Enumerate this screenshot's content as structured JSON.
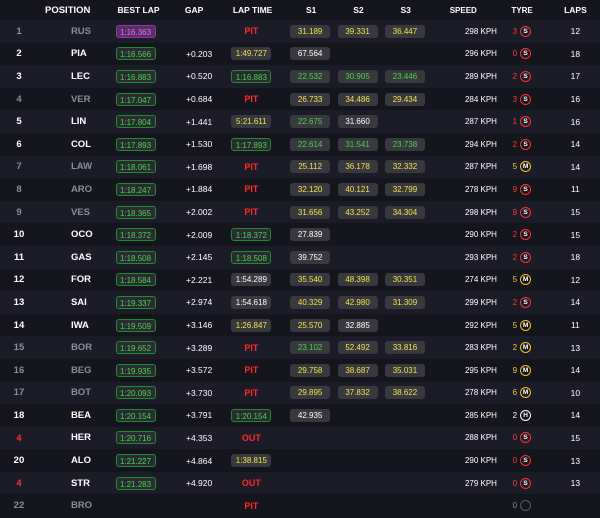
{
  "headers": {
    "position": "POSITION",
    "best_lap": "BEST LAP",
    "gap": "GAP",
    "lap_time": "LAP TIME",
    "s1": "S1",
    "s2": "S2",
    "s3": "S3",
    "speed": "SPEED",
    "tyre": "TYRE",
    "laps": "LAPS"
  },
  "colors": {
    "background": "#15151e",
    "row_alt": "#1c1c28",
    "personal_best": "#4ad34a",
    "sector_yellow": "#f2e34a",
    "fastest_purple": "#d77bd7",
    "pit_red": "#ff2a2a"
  },
  "rows": [
    {
      "pos": "1",
      "driver": "RUS",
      "dim": true,
      "best": "1:16.363",
      "best_style": "purple",
      "gap": "",
      "lt": "PIT",
      "lt_style": "pit",
      "s1": "31.189",
      "s1c": "yellow",
      "s2": "39.331",
      "s2c": "yellow",
      "s3": "36.447",
      "s3c": "yellow",
      "speed": "298 KPH",
      "tyre_age": "3",
      "tyre_age_color": "red",
      "tyre": "S",
      "laps": "12"
    },
    {
      "pos": "2",
      "driver": "PIA",
      "dim": false,
      "best": "1:16.566",
      "best_style": "green",
      "gap": "+0.203",
      "lt": "1:49.727",
      "lt_style": "yellow",
      "s1": "67.564",
      "s1c": "white",
      "s2": "",
      "s2c": "",
      "s3": "",
      "s3c": "",
      "speed": "296 KPH",
      "tyre_age": "0",
      "tyre_age_color": "red",
      "tyre": "S",
      "laps": "18"
    },
    {
      "pos": "3",
      "driver": "LEC",
      "dim": false,
      "best": "1:16.883",
      "best_style": "green",
      "gap": "+0.520",
      "lt": "1:16.883",
      "lt_style": "green",
      "s1": "22.532",
      "s1c": "green",
      "s2": "30.905",
      "s2c": "green",
      "s3": "23.446",
      "s3c": "green",
      "speed": "289 KPH",
      "tyre_age": "2",
      "tyre_age_color": "red",
      "tyre": "S",
      "laps": "17"
    },
    {
      "pos": "4",
      "driver": "VER",
      "dim": true,
      "best": "1:17.047",
      "best_style": "green",
      "gap": "+0.684",
      "lt": "PIT",
      "lt_style": "pit",
      "s1": "26.733",
      "s1c": "yellow",
      "s2": "34.486",
      "s2c": "yellow",
      "s3": "29.434",
      "s3c": "yellow",
      "speed": "284 KPH",
      "tyre_age": "3",
      "tyre_age_color": "red",
      "tyre": "S",
      "laps": "16"
    },
    {
      "pos": "5",
      "driver": "LIN",
      "dim": false,
      "best": "1:17.804",
      "best_style": "green",
      "gap": "+1.441",
      "lt": "5:21.611",
      "lt_style": "yellow",
      "s1": "22.675",
      "s1c": "green",
      "s2": "31.660",
      "s2c": "white",
      "s3": "",
      "s3c": "",
      "speed": "287 KPH",
      "tyre_age": "1",
      "tyre_age_color": "red",
      "tyre": "S",
      "laps": "16"
    },
    {
      "pos": "6",
      "driver": "COL",
      "dim": false,
      "best": "1:17.893",
      "best_style": "green",
      "gap": "+1.530",
      "lt": "1:17.893",
      "lt_style": "green",
      "s1": "22.614",
      "s1c": "green",
      "s2": "31.541",
      "s2c": "green",
      "s3": "23.738",
      "s3c": "green",
      "speed": "294 KPH",
      "tyre_age": "2",
      "tyre_age_color": "red",
      "tyre": "S",
      "laps": "14"
    },
    {
      "pos": "7",
      "driver": "LAW",
      "dim": true,
      "best": "1:18.061",
      "best_style": "green",
      "gap": "+1.698",
      "lt": "PIT",
      "lt_style": "pit",
      "s1": "25.112",
      "s1c": "yellow",
      "s2": "36.178",
      "s2c": "yellow",
      "s3": "32.332",
      "s3c": "yellow",
      "speed": "287 KPH",
      "tyre_age": "5",
      "tyre_age_color": "ylw",
      "tyre": "M",
      "laps": "14"
    },
    {
      "pos": "8",
      "driver": "ARO",
      "dim": true,
      "best": "1:18.247",
      "best_style": "green",
      "gap": "+1.884",
      "lt": "PIT",
      "lt_style": "pit",
      "s1": "32.120",
      "s1c": "yellow",
      "s2": "40.121",
      "s2c": "yellow",
      "s3": "32.799",
      "s3c": "yellow",
      "speed": "278 KPH",
      "tyre_age": "9",
      "tyre_age_color": "red",
      "tyre": "S",
      "laps": "11"
    },
    {
      "pos": "9",
      "driver": "VES",
      "dim": true,
      "best": "1:18.365",
      "best_style": "green",
      "gap": "+2.002",
      "lt": "PIT",
      "lt_style": "pit",
      "s1": "31.656",
      "s1c": "yellow",
      "s2": "43.252",
      "s2c": "yellow",
      "s3": "34.304",
      "s3c": "yellow",
      "speed": "298 KPH",
      "tyre_age": "9",
      "tyre_age_color": "red",
      "tyre": "S",
      "laps": "15"
    },
    {
      "pos": "10",
      "driver": "OCO",
      "dim": false,
      "best": "1:18.372",
      "best_style": "green",
      "gap": "+2.009",
      "lt": "1:18.372",
      "lt_style": "green",
      "s1": "27.839",
      "s1c": "white",
      "s2": "",
      "s2c": "",
      "s3": "",
      "s3c": "",
      "speed": "290 KPH",
      "tyre_age": "2",
      "tyre_age_color": "red",
      "tyre": "S",
      "laps": "15"
    },
    {
      "pos": "11",
      "driver": "GAS",
      "dim": false,
      "best": "1:18.508",
      "best_style": "green",
      "gap": "+2.145",
      "lt": "1:18.508",
      "lt_style": "green",
      "s1": "39.752",
      "s1c": "white",
      "s2": "",
      "s2c": "",
      "s3": "",
      "s3c": "",
      "speed": "293 KPH",
      "tyre_age": "2",
      "tyre_age_color": "red",
      "tyre": "S",
      "laps": "18"
    },
    {
      "pos": "12",
      "driver": "FOR",
      "dim": false,
      "best": "1:18.584",
      "best_style": "green",
      "gap": "+2.221",
      "lt": "1:54.289",
      "lt_style": "white",
      "s1": "35.540",
      "s1c": "yellow",
      "s2": "48.398",
      "s2c": "yellow",
      "s3": "30.351",
      "s3c": "yellow",
      "speed": "274 KPH",
      "tyre_age": "5",
      "tyre_age_color": "ylw",
      "tyre": "M",
      "laps": "12"
    },
    {
      "pos": "13",
      "driver": "SAI",
      "dim": false,
      "best": "1:19.337",
      "best_style": "green",
      "gap": "+2.974",
      "lt": "1:54.618",
      "lt_style": "white",
      "s1": "40.329",
      "s1c": "yellow",
      "s2": "42.980",
      "s2c": "yellow",
      "s3": "31.309",
      "s3c": "yellow",
      "speed": "299 KPH",
      "tyre_age": "2",
      "tyre_age_color": "red",
      "tyre": "S",
      "laps": "14"
    },
    {
      "pos": "14",
      "driver": "IWA",
      "dim": false,
      "best": "1:19.509",
      "best_style": "green",
      "gap": "+3.146",
      "lt": "1:26.847",
      "lt_style": "yellow",
      "s1": "25.570",
      "s1c": "yellow",
      "s2": "32.885",
      "s2c": "white",
      "s3": "",
      "s3c": "",
      "speed": "292 KPH",
      "tyre_age": "5",
      "tyre_age_color": "ylw",
      "tyre": "M",
      "laps": "11"
    },
    {
      "pos": "15",
      "driver": "BOR",
      "dim": true,
      "best": "1:19.652",
      "best_style": "green",
      "gap": "+3.289",
      "lt": "PIT",
      "lt_style": "pit",
      "s1": "23.102",
      "s1c": "green",
      "s2": "52.492",
      "s2c": "yellow",
      "s3": "33.816",
      "s3c": "yellow",
      "speed": "283 KPH",
      "tyre_age": "2",
      "tyre_age_color": "ylw",
      "tyre": "M",
      "laps": "13"
    },
    {
      "pos": "16",
      "driver": "BEG",
      "dim": true,
      "best": "1:19.935",
      "best_style": "green",
      "gap": "+3.572",
      "lt": "PIT",
      "lt_style": "pit",
      "s1": "29.758",
      "s1c": "yellow",
      "s2": "38.687",
      "s2c": "yellow",
      "s3": "35.031",
      "s3c": "yellow",
      "speed": "295 KPH",
      "tyre_age": "9",
      "tyre_age_color": "ylw",
      "tyre": "M",
      "laps": "14"
    },
    {
      "pos": "17",
      "driver": "BOT",
      "dim": true,
      "best": "1:20.093",
      "best_style": "green",
      "gap": "+3.730",
      "lt": "PIT",
      "lt_style": "pit",
      "s1": "29.895",
      "s1c": "yellow",
      "s2": "37.832",
      "s2c": "yellow",
      "s3": "38.622",
      "s3c": "yellow",
      "speed": "278 KPH",
      "tyre_age": "6",
      "tyre_age_color": "ylw",
      "tyre": "M",
      "laps": "10"
    },
    {
      "pos": "18",
      "driver": "BEA",
      "dim": false,
      "best": "1:20.154",
      "best_style": "green",
      "gap": "+3.791",
      "lt": "1:20.154",
      "lt_style": "green",
      "s1": "42.935",
      "s1c": "white",
      "s2": "",
      "s2c": "",
      "s3": "",
      "s3c": "",
      "speed": "285 KPH",
      "tyre_age": "2",
      "tyre_age_color": "white",
      "tyre": "H",
      "laps": "14"
    },
    {
      "pos": "4",
      "driver": "HER",
      "dim": false,
      "retired": true,
      "best": "1:20.716",
      "best_style": "green",
      "gap": "+4.353",
      "lt": "OUT",
      "lt_style": "out",
      "s1": "",
      "s1c": "",
      "s2": "",
      "s2c": "",
      "s3": "",
      "s3c": "",
      "speed": "288 KPH",
      "tyre_age": "0",
      "tyre_age_color": "red",
      "tyre": "S",
      "laps": "15"
    },
    {
      "pos": "20",
      "driver": "ALO",
      "dim": false,
      "best": "1:21.227",
      "best_style": "green",
      "gap": "+4.864",
      "lt": "1:38.815",
      "lt_style": "yellow",
      "s1": "",
      "s1c": "",
      "s2": "",
      "s2c": "",
      "s3": "",
      "s3c": "",
      "speed": "290 KPH",
      "tyre_age": "0",
      "tyre_age_color": "red",
      "tyre": "S",
      "laps": "13"
    },
    {
      "pos": "4",
      "driver": "STR",
      "dim": false,
      "retired": true,
      "best": "1:21.283",
      "best_style": "green",
      "gap": "+4.920",
      "lt": "OUT",
      "lt_style": "out",
      "s1": "",
      "s1c": "",
      "s2": "",
      "s2c": "",
      "s3": "",
      "s3c": "",
      "speed": "279 KPH",
      "tyre_age": "0",
      "tyre_age_color": "red",
      "tyre": "S",
      "laps": "13"
    },
    {
      "pos": "22",
      "driver": "BRO",
      "dim": true,
      "best": "",
      "best_style": "",
      "gap": "",
      "lt": "PIT",
      "lt_style": "pit",
      "s1": "",
      "s1c": "",
      "s2": "",
      "s2c": "",
      "s3": "",
      "s3c": "",
      "speed": "",
      "tyre_age": "0",
      "tyre_age_color": "dim",
      "tyre": "N",
      "laps": ""
    }
  ]
}
